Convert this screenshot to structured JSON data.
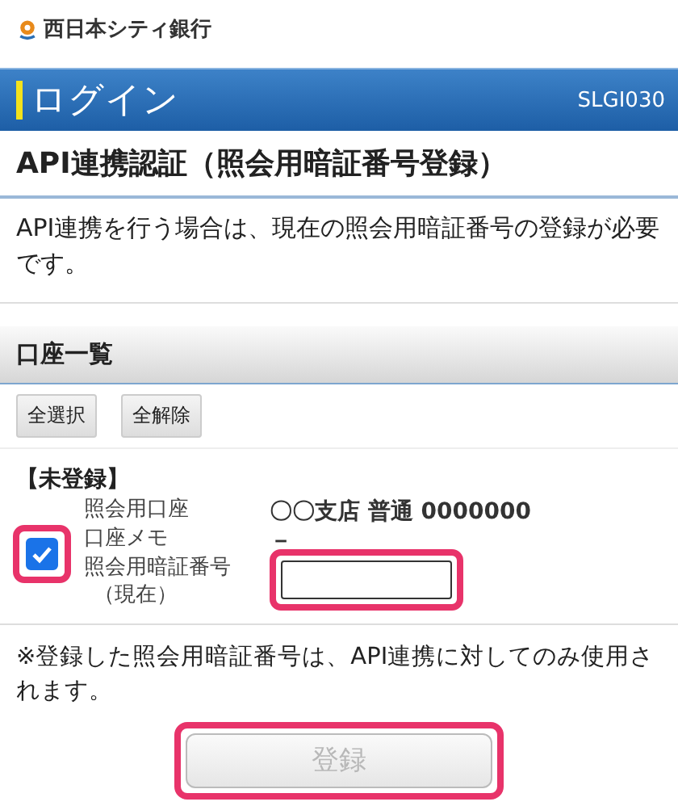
{
  "brand": {
    "name": "西日本シティ銀行"
  },
  "header": {
    "title": "ログイン",
    "screen_id": "SLGI030"
  },
  "page_title": "API連携認証（照会用暗証番号登録）",
  "description": "API連携を行う場合は、現在の照会用暗証番号の登録が必要です。",
  "section": {
    "title": "口座一覧"
  },
  "bulk_buttons": [
    "全選択",
    "全解除"
  ],
  "group_label": "【未登録】",
  "accounts": [
    {
      "checked": true,
      "highlighted": true,
      "fields": [
        {
          "label": "照会用口座",
          "value": "〇〇支店 普通 0000000"
        },
        {
          "label": "口座メモ",
          "value": "－"
        }
      ],
      "pin": {
        "label": "照会用暗証番号",
        "sublabel": "（現在）",
        "highlighted": true
      }
    }
  ],
  "note": "※登録した照会用暗証番号は、API連携に対してのみ使用されます。",
  "submit": {
    "label": "登録",
    "disabled": true,
    "highlighted": true
  }
}
